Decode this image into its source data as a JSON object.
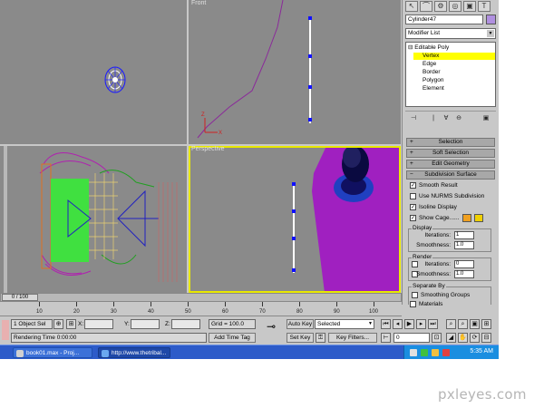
{
  "viewports": {
    "front_label": "Front",
    "perspective_label": "Perspective"
  },
  "panel": {
    "object_name": "Cylinder47",
    "object_color": "#b090e0",
    "modifier_list": "Modifier List",
    "stack": [
      "Editable Poly",
      "Vertex",
      "Edge",
      "Border",
      "Polygon",
      "Element"
    ],
    "selected_subobject": "Vertex",
    "rollouts": [
      "Selection",
      "Soft Selection",
      "Edit Geometry",
      "Subdivision Surface"
    ],
    "checks": {
      "smooth_result": "Smooth Result",
      "nurms": "Use NURMS Subdivision",
      "isoline": "Isoline Display",
      "show_cage": "Show Cage......"
    },
    "display_group": "Display",
    "render_group": "Render",
    "separate_group": "Separate By",
    "iterations_label": "Iterations:",
    "smoothness_label": "Smoothness:",
    "display_iterations": "1",
    "display_smoothness": "1.0",
    "render_iterations": "0",
    "render_smoothness": "1.0",
    "smoothing_groups": "Smoothing Groups",
    "materials": "Materials",
    "cage_color_1": "#f0a020",
    "cage_color_2": "#f0d000"
  },
  "timeline": {
    "slider": "0 / 100",
    "ticks": [
      "10",
      "20",
      "30",
      "40",
      "50",
      "60",
      "70",
      "80",
      "90",
      "100"
    ]
  },
  "status": {
    "selection": "1 Object Sel",
    "x_label": "X:",
    "y_label": "Y:",
    "z_label": "Z:",
    "grid": "Grid = 100.0",
    "rendering_time": "Rendering Time  0:00:00",
    "add_time_tag": "Add Time Tag",
    "auto_key": "Auto Key",
    "set_key": "Set Key",
    "selected": "Selected",
    "key_filters": "Key Filters...",
    "frame": "0"
  },
  "taskbar": {
    "items": [
      "book01.max   - Proj...",
      "http://www.thetribal..."
    ],
    "clock": "5:35 AM"
  },
  "watermark": "pxleyes.com"
}
